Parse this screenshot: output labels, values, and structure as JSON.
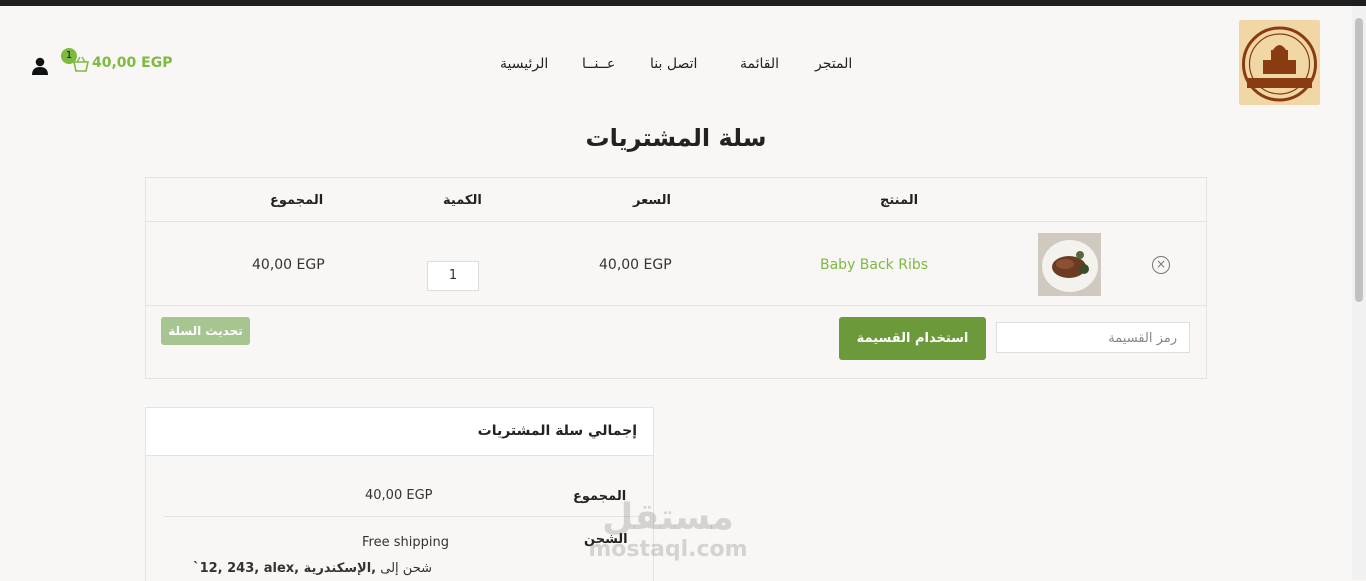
{
  "header": {
    "logo_text": "مطعم الأصالة ALEXANDRIA SINCE 50 YEARS",
    "nav": [
      "المتجر",
      "القائمة",
      "اتصل بنا",
      "عــنــا",
      "الرئيسية"
    ],
    "cart_count": "1",
    "cart_total": "40,00 EGP"
  },
  "page_title": "سلة المشتريات",
  "cart_table": {
    "headers": {
      "product": "المنتج",
      "price": "السعر",
      "quantity": "الكمية",
      "subtotal": "المجموع"
    },
    "row": {
      "remove": "×",
      "product_name": "Baby Back Ribs",
      "price": "40,00 EGP",
      "quantity": "1",
      "subtotal": "40,00 EGP"
    },
    "coupon_placeholder": "رمز القسيمة",
    "apply_coupon": "استخدام القسيمة",
    "update_cart": "تحديث السلة"
  },
  "totals": {
    "title": "إجمالي سلة المشتريات",
    "subtotal_label": "المجموع",
    "subtotal_value": "40,00 EGP",
    "shipping_label": "الشحن",
    "shipping_value": "Free shipping",
    "ship_to_prefix": "شحن إلى",
    "ship_to_address": "`12, 243, alex, الإسكندرية,"
  },
  "watermark": {
    "ar": "مستقل",
    "en": "mostaql.com"
  },
  "colors": {
    "accent": "#7dba3f",
    "button": "#6c9a3a",
    "button_disabled": "#a6c590"
  }
}
